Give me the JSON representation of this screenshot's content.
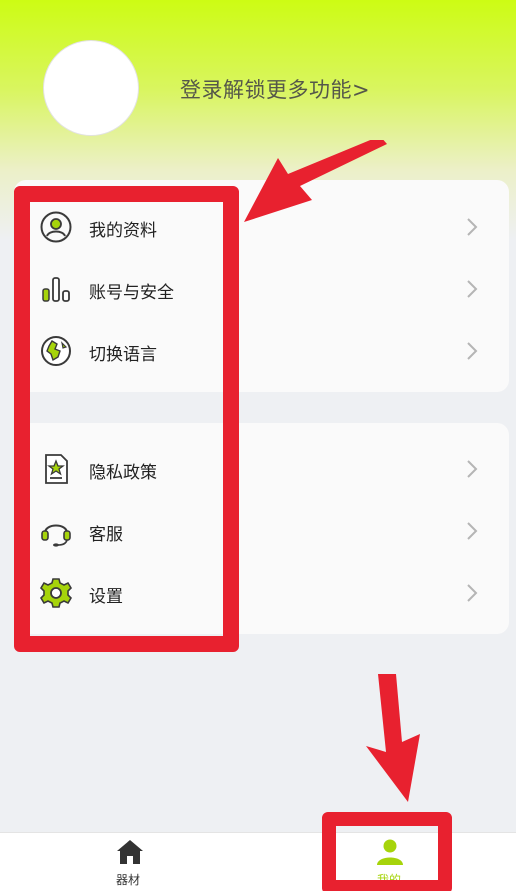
{
  "header": {
    "login_prompt": "登录解锁更多功能>"
  },
  "menu_group_1": [
    {
      "label": "我的资料",
      "icon": "profile-icon"
    },
    {
      "label": "账号与安全",
      "icon": "bar-chart-icon"
    },
    {
      "label": "切换语言",
      "icon": "globe-icon"
    }
  ],
  "menu_group_2": [
    {
      "label": "隐私政策",
      "icon": "document-star-icon"
    },
    {
      "label": "客服",
      "icon": "headset-icon"
    },
    {
      "label": "设置",
      "icon": "gear-icon"
    }
  ],
  "tabbar": {
    "tabs": [
      {
        "label": "器材",
        "icon": "home-icon",
        "active": false
      },
      {
        "label": "我的",
        "icon": "person-icon",
        "active": true
      }
    ]
  },
  "colors": {
    "accent": "#a6d40b",
    "annotation": "#e8212f",
    "header_top": "#cdfc14"
  }
}
